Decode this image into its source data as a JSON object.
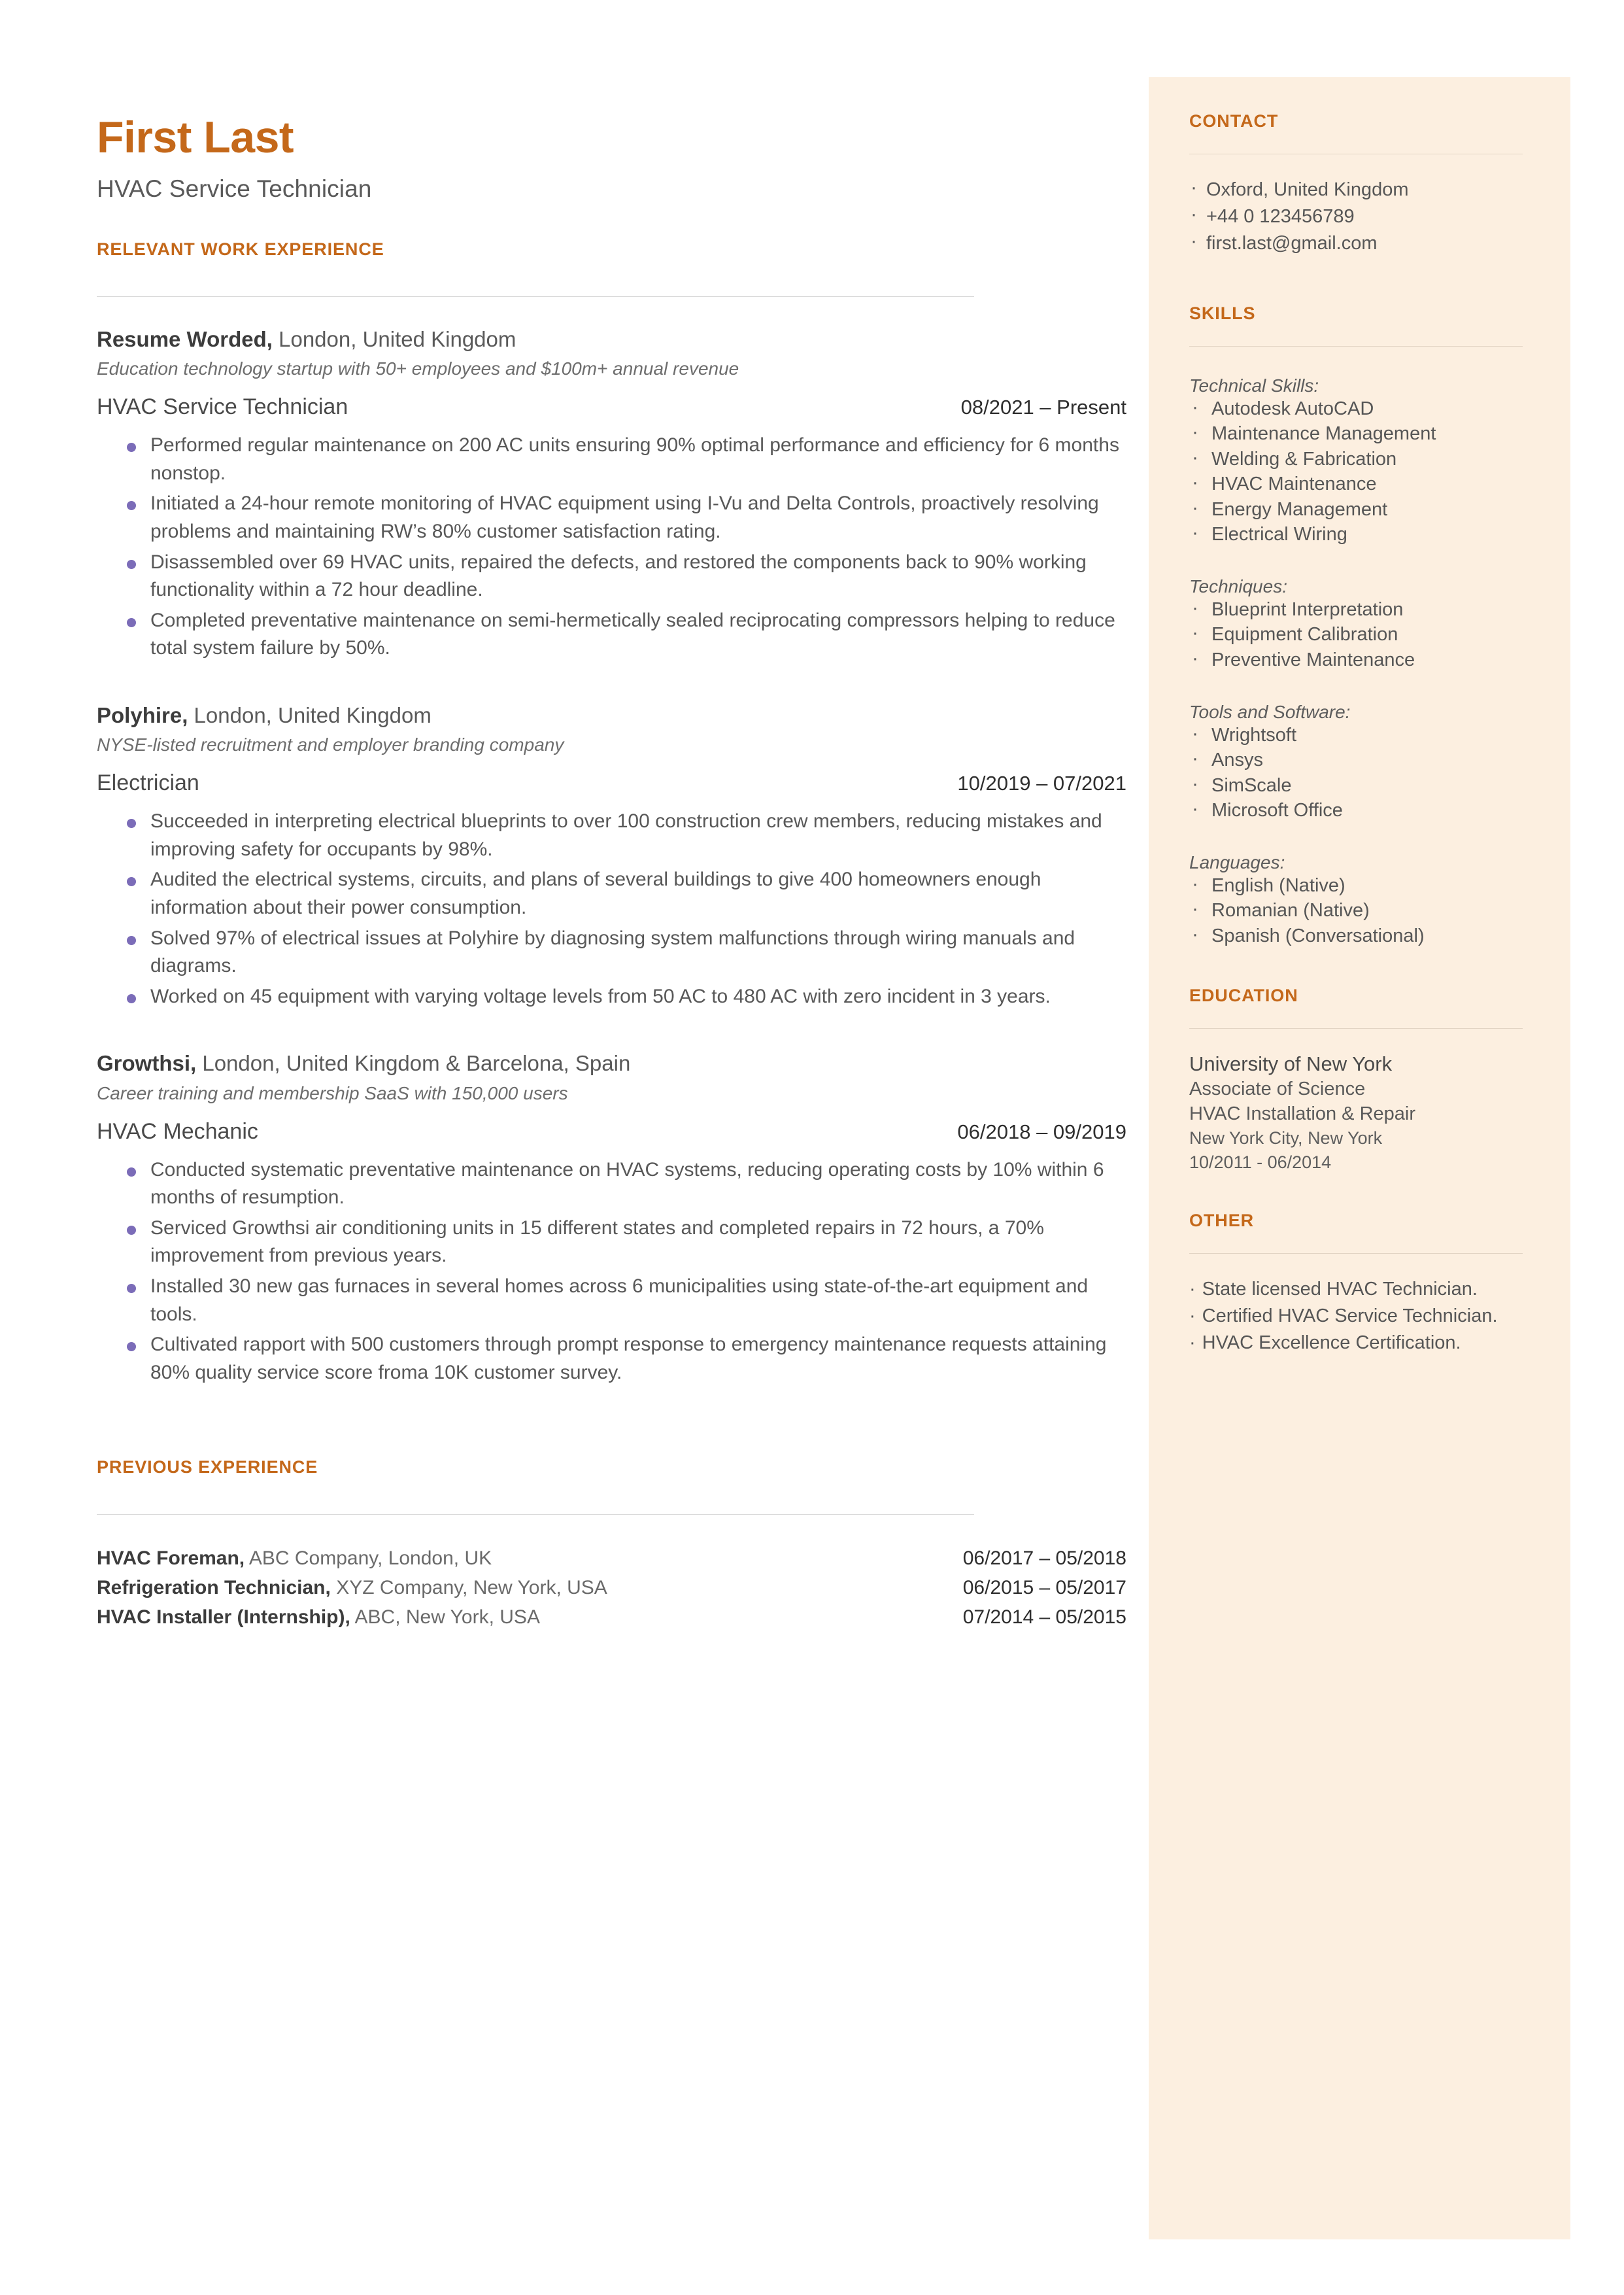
{
  "header": {
    "name": "First Last",
    "title": "HVAC Service Technician"
  },
  "colors": {
    "accent": "#c4681a",
    "sidebar_bg": "#fcefe0",
    "bullet": "#7b6cb8",
    "body_text": "#585858"
  },
  "main": {
    "work_section_heading": "RELEVANT WORK EXPERIENCE",
    "previous_section_heading": "PREVIOUS EXPERIENCE",
    "jobs": [
      {
        "company": "Resume Worded,",
        "location": " London, United Kingdom",
        "description": "Education technology startup with 50+ employees and $100m+ annual revenue",
        "role": "HVAC Service Technician",
        "date": "08/2021 – Present",
        "bullets": [
          "Performed regular maintenance on 200 AC units ensuring 90% optimal performance and efficiency for 6 months nonstop.",
          "Initiated a 24-hour remote monitoring of HVAC equipment using I-Vu and Delta Controls, proactively resolving problems and maintaining RW’s 80% customer satisfaction rating.",
          "Disassembled over 69 HVAC units, repaired the defects, and restored the components back to 90% working functionality within a 72 hour deadline.",
          "Completed preventative maintenance on semi-hermetically sealed reciprocating compressors helping to reduce total system failure by 50%."
        ]
      },
      {
        "company": "Polyhire,",
        "location": " London, United Kingdom",
        "description": "NYSE-listed recruitment and employer branding company",
        "role": "Electrician",
        "date": "10/2019 – 07/2021",
        "bullets": [
          "Succeeded in interpreting electrical blueprints to over 100 construction crew members, reducing mistakes and improving safety for occupants by 98%.",
          "Audited the electrical systems, circuits, and plans of several buildings to give 400 homeowners enough information about their power consumption.",
          "Solved 97% of electrical issues at Polyhire by diagnosing system malfunctions through wiring manuals and diagrams.",
          "Worked on 45 equipment with varying voltage levels from 50 AC to 480 AC with zero incident in 3 years."
        ]
      },
      {
        "company": "Growthsi,",
        "location": " London, United Kingdom & Barcelona, Spain",
        "description": "Career training and membership SaaS with 150,000 users",
        "role": "HVAC Mechanic",
        "date": "06/2018 – 09/2019",
        "bullets": [
          "Conducted systematic preventative maintenance on HVAC systems, reducing operating costs by 10% within 6 months of resumption.",
          "Serviced Growthsi air conditioning units in 15 different states and completed repairs in 72 hours, a 70% improvement from previous years.",
          "Installed 30 new gas furnaces in several homes across 6 municipalities using state-of-the-art equipment and tools.",
          "Cultivated rapport with 500 customers through prompt response to emergency maintenance requests attaining 80% quality service score froma 10K customer survey."
        ]
      }
    ],
    "previous": [
      {
        "title": "HVAC Foreman,",
        "detail": " ABC Company, London, UK",
        "date": "06/2017 – 05/2018"
      },
      {
        "title": "Refrigeration Technician,",
        "detail": " XYZ Company, New York, USA",
        "date": "06/2015 – 05/2017"
      },
      {
        "title": "HVAC Installer (Internship),",
        "detail": " ABC, New York, USA",
        "date": "07/2014 – 05/2015"
      }
    ]
  },
  "sidebar": {
    "contact": {
      "heading": "CONTACT",
      "items": [
        "Oxford, United Kingdom",
        "+44 0 123456789",
        "first.last@gmail.com"
      ]
    },
    "skills": {
      "heading": "SKILLS",
      "groups": [
        {
          "label": "Technical Skills:",
          "items": [
            "Autodesk AutoCAD",
            "Maintenance Management",
            "Welding & Fabrication",
            "HVAC Maintenance",
            "Energy Management",
            "Electrical Wiring"
          ]
        },
        {
          "label": "Techniques:",
          "items": [
            "Blueprint Interpretation",
            "Equipment Calibration",
            "Preventive Maintenance"
          ]
        },
        {
          "label": "Tools and Software:",
          "items": [
            "Wrightsoft",
            "Ansys",
            "SimScale",
            "Microsoft Office"
          ]
        },
        {
          "label": "Languages:",
          "items": [
            "English (Native)",
            "Romanian (Native)",
            "Spanish (Conversational)"
          ]
        }
      ]
    },
    "education": {
      "heading": "EDUCATION",
      "school": "University of New York",
      "degree": "Associate of Science",
      "field": "HVAC Installation & Repair",
      "location": "New York City, New York",
      "dates": "10/2011 - 06/2014"
    },
    "other": {
      "heading": "OTHER",
      "items": [
        "State licensed HVAC Technician.",
        "Certified HVAC Service Technician.",
        "HVAC Excellence Certification."
      ]
    }
  }
}
